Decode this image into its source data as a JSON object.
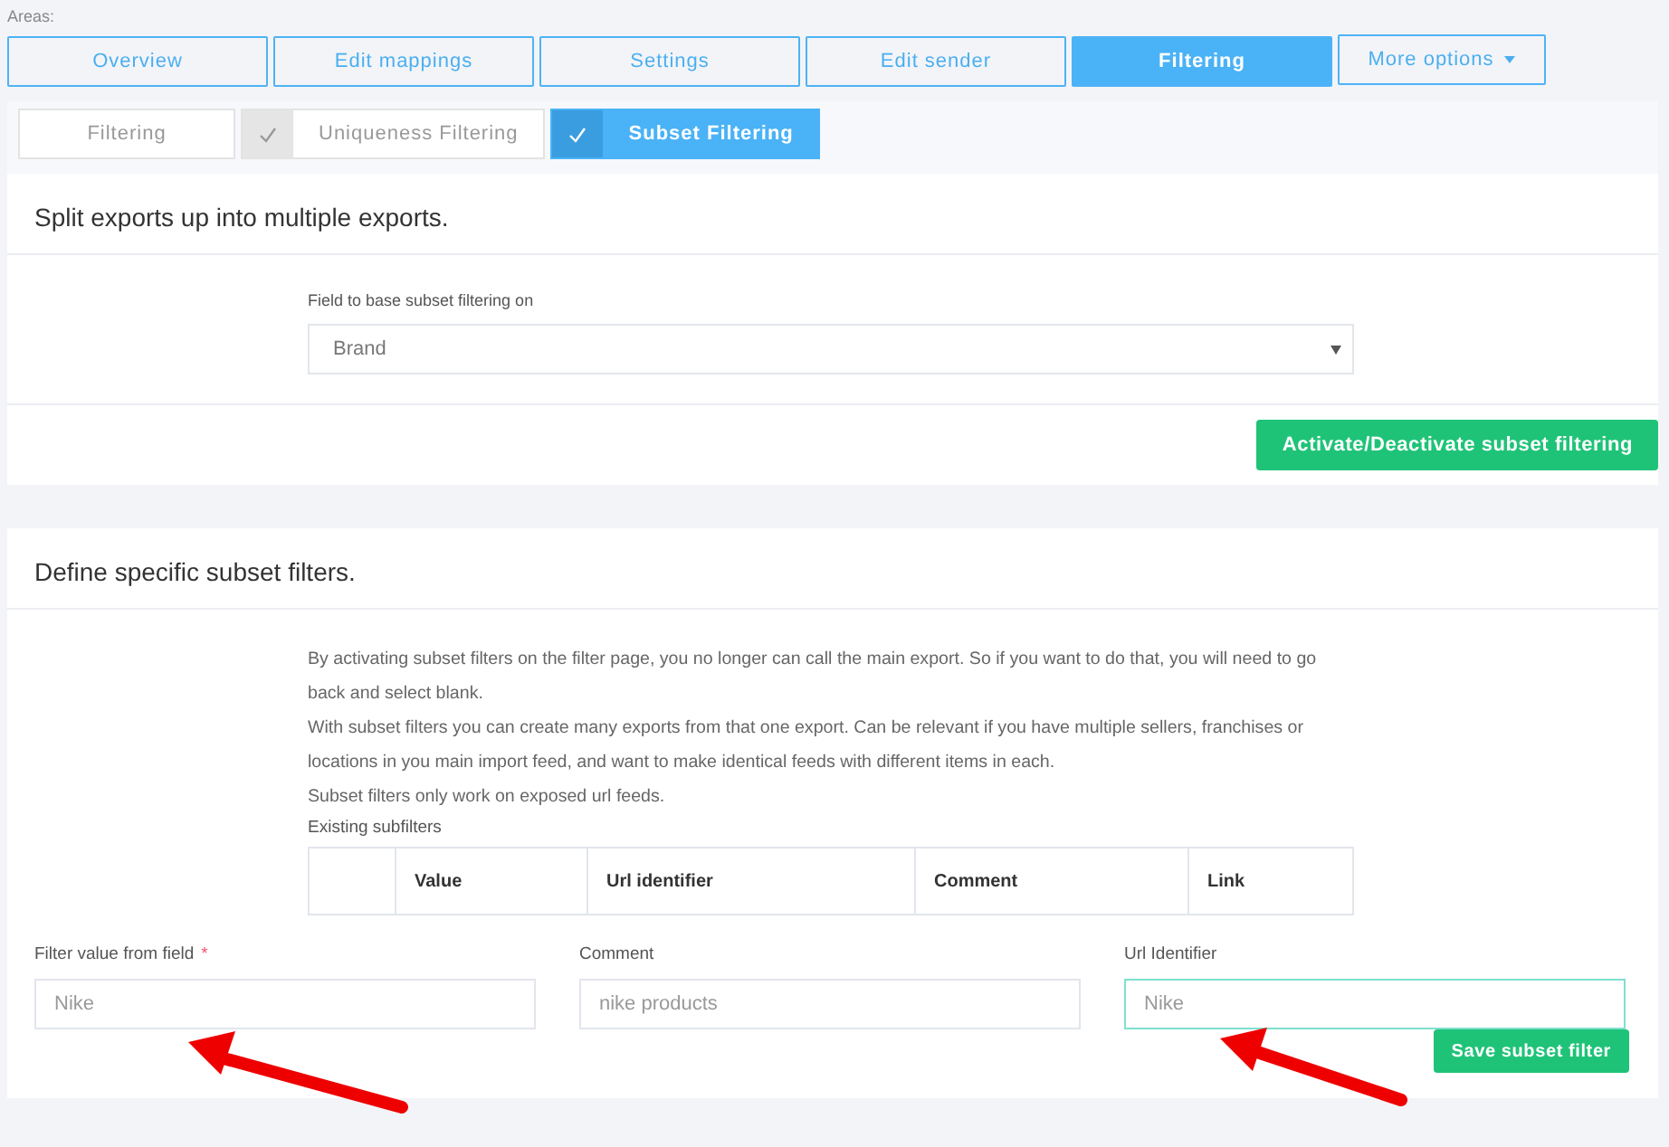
{
  "areas_label": "Areas:",
  "nav_tabs": [
    {
      "kind": "tab",
      "label": "Overview",
      "selected": false
    },
    {
      "kind": "tab",
      "label": "Edit mappings",
      "selected": false
    },
    {
      "kind": "tab",
      "label": "Settings",
      "selected": false
    },
    {
      "kind": "tab",
      "label": "Edit sender",
      "selected": false
    },
    {
      "kind": "tab",
      "label": "Filtering",
      "selected": true
    },
    {
      "kind": "menu",
      "label": "More options",
      "selected": false
    }
  ],
  "sub_tabs": [
    {
      "kind": "plain",
      "label": "Filtering",
      "selected": false
    },
    {
      "kind": "check",
      "label": "Uniqueness Filtering",
      "selected": false
    },
    {
      "kind": "check",
      "label": "Subset Filtering",
      "selected": true
    }
  ],
  "split_card": {
    "heading": "Split exports up into multiple exports.",
    "field_label": "Field to base subset filtering on",
    "select_value": "Brand",
    "button": "Activate/Deactivate subset filtering"
  },
  "subset_card": {
    "heading": "Define specific subset filters.",
    "paragraphs": [
      "By activating subset filters on the filter page, you no longer can call the main export. So if you want to do that, you will need to go back and select blank.",
      "With subset filters you can create many exports from that one export. Can be relevant if you have multiple sellers, franchises or locations in you main import feed, and want to make identical feeds with different items in each.",
      "Subset filters only work on exposed url feeds."
    ],
    "table_title": "Existing subfilters",
    "table_columns": [
      "Value",
      "Url identifier",
      "Comment",
      "Link"
    ],
    "fields": [
      {
        "label": "Filter value from field",
        "required_mark": "*",
        "value": "Nike",
        "focused": false
      },
      {
        "label": "Comment",
        "value": "nike products",
        "focused": false
      },
      {
        "label": "Url Identifier",
        "value": "Nike",
        "focused": true
      }
    ],
    "save_button": "Save subset filter"
  }
}
